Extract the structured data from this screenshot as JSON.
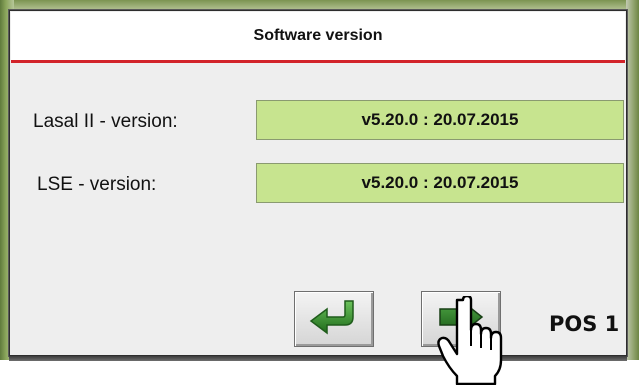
{
  "dialog": {
    "title": "Software version"
  },
  "rows": [
    {
      "label": "Lasal II - version:",
      "value": "v5.20.0 : 20.07.2015"
    },
    {
      "label": "LSE - version:",
      "value": "v5.20.0 : 20.07.2015"
    }
  ],
  "buttons": {
    "back": {
      "icon": "return-arrow-icon"
    },
    "next": {
      "icon": "forward-arrow-icon"
    }
  },
  "annotation": {
    "position_label": "POS 1"
  },
  "colors": {
    "title_rule": "#d2232a",
    "value_bg": "#c7e48f",
    "arrow_green": "#2f8a2a",
    "arrow_dark": "#1f5c1b",
    "dialog_bg": "#eeeeee"
  }
}
